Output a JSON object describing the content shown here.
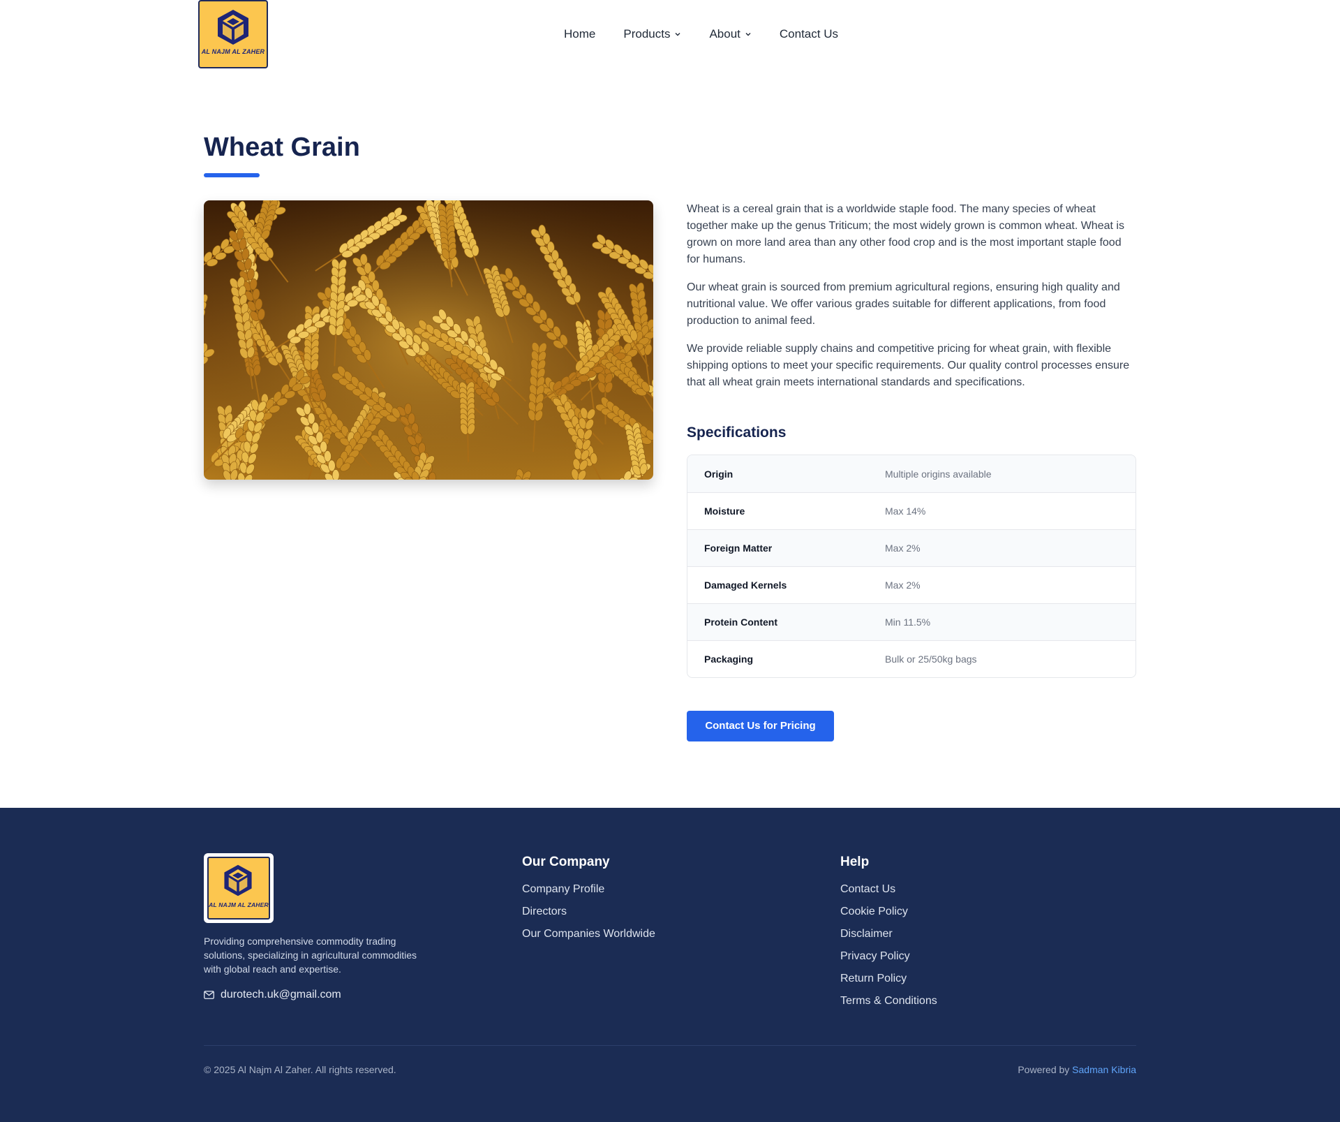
{
  "brand": {
    "logo_text": "AL NAJM AL ZAHER",
    "accent": "#2563eb",
    "navy": "#1b2c54",
    "gold": "#fcc64f"
  },
  "nav": {
    "items": [
      {
        "label": "Home",
        "has_dropdown": false
      },
      {
        "label": "Products",
        "has_dropdown": true
      },
      {
        "label": "About",
        "has_dropdown": true
      },
      {
        "label": "Contact Us",
        "has_dropdown": false
      }
    ]
  },
  "product": {
    "title": "Wheat Grain",
    "image_icon": "wheat-field-photo",
    "paragraphs": [
      "Wheat is a cereal grain that is a worldwide staple food. The many species of wheat together make up the genus Triticum; the most widely grown is common wheat. Wheat is grown on more land area than any other food crop and is the most important staple food for humans.",
      "Our wheat grain is sourced from premium agricultural regions, ensuring high quality and nutritional value. We offer various grades suitable for different applications, from food production to animal feed.",
      "We provide reliable supply chains and competitive pricing for wheat grain, with flexible shipping options to meet your specific requirements. Our quality control processes ensure that all wheat grain meets international standards and specifications."
    ],
    "spec_heading": "Specifications",
    "specs": [
      {
        "key": "Origin",
        "value": "Multiple origins available"
      },
      {
        "key": "Moisture",
        "value": "Max 14%"
      },
      {
        "key": "Foreign Matter",
        "value": "Max 2%"
      },
      {
        "key": "Damaged Kernels",
        "value": "Max 2%"
      },
      {
        "key": "Protein Content",
        "value": "Min 11.5%"
      },
      {
        "key": "Packaging",
        "value": "Bulk or 25/50kg bags"
      }
    ],
    "cta_label": "Contact Us for Pricing"
  },
  "footer": {
    "about": "Providing comprehensive commodity trading solutions, specializing in agricultural commodities with global reach and expertise.",
    "email": "durotech.uk@gmail.com",
    "company": {
      "title": "Our Company",
      "links": [
        "Company Profile",
        "Directors",
        "Our Companies Worldwide"
      ]
    },
    "help": {
      "title": "Help",
      "links": [
        "Contact Us",
        "Cookie Policy",
        "Disclaimer",
        "Privacy Policy",
        "Return Policy",
        "Terms & Conditions"
      ]
    },
    "copyright": "© 2025 Al Najm Al Zaher. All rights reserved.",
    "powered_prefix": "Powered by",
    "powered_name": "Sadman Kibria"
  }
}
